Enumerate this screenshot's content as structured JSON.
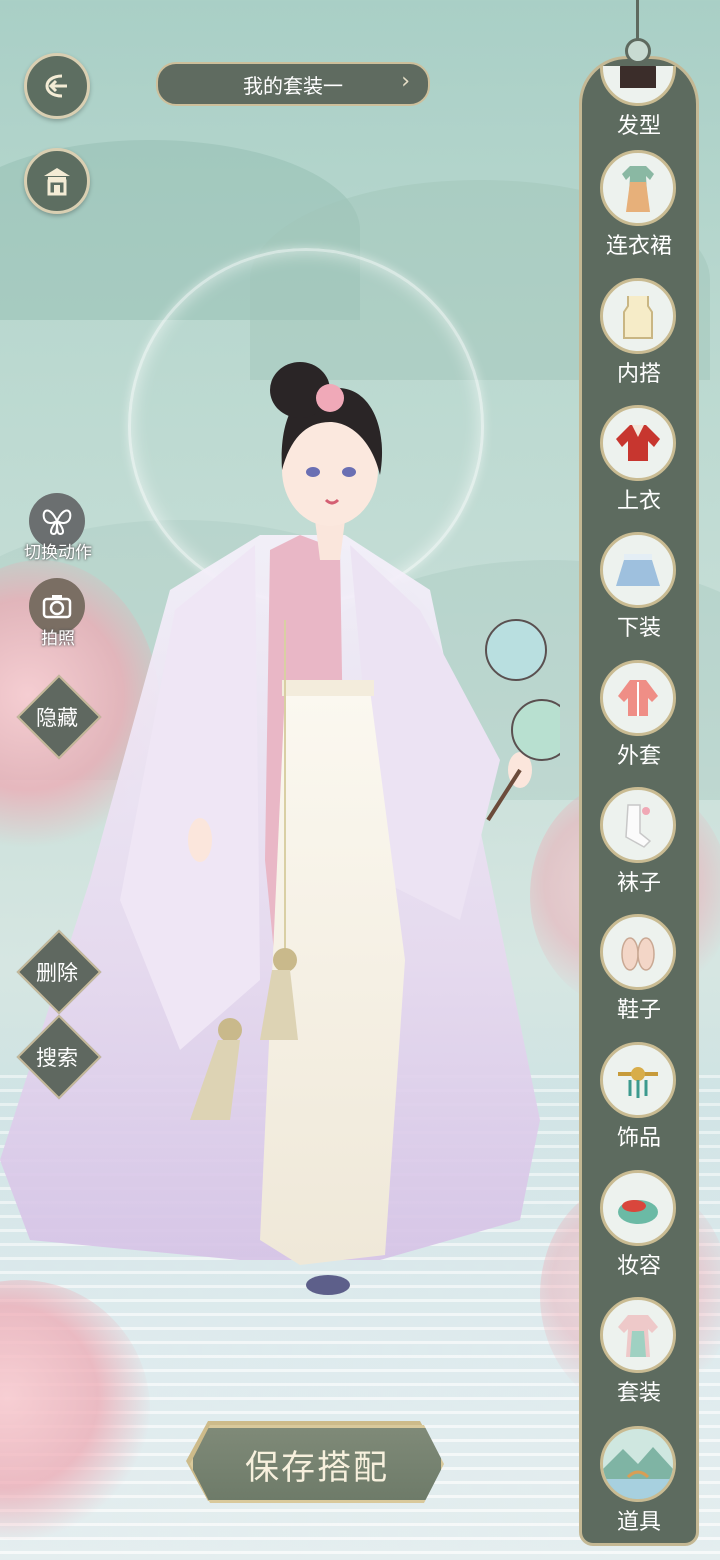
{
  "outfit": {
    "name": "我的套装一"
  },
  "left_actions": {
    "switch_pose": "切换动作",
    "photo": "拍照",
    "hide": "隐藏",
    "delete": "删除",
    "search": "搜索"
  },
  "categories": [
    {
      "label": "发型",
      "icon": "hairstyle-icon"
    },
    {
      "label": "连衣裙",
      "icon": "dress-icon"
    },
    {
      "label": "内搭",
      "icon": "inner-wear-icon"
    },
    {
      "label": "上衣",
      "icon": "top-icon"
    },
    {
      "label": "下装",
      "icon": "skirt-icon"
    },
    {
      "label": "外套",
      "icon": "coat-icon"
    },
    {
      "label": "袜子",
      "icon": "socks-icon"
    },
    {
      "label": "鞋子",
      "icon": "shoes-icon"
    },
    {
      "label": "饰品",
      "icon": "accessory-icon"
    },
    {
      "label": "妆容",
      "icon": "makeup-icon"
    },
    {
      "label": "套装",
      "icon": "outfit-set-icon"
    },
    {
      "label": "道具",
      "icon": "props-icon"
    }
  ],
  "save_button": {
    "label": "保存搭配"
  },
  "colors": {
    "panel": "#5d6b5f",
    "gold_border": "#c9bb92",
    "button_dark": "#5f6b60"
  }
}
